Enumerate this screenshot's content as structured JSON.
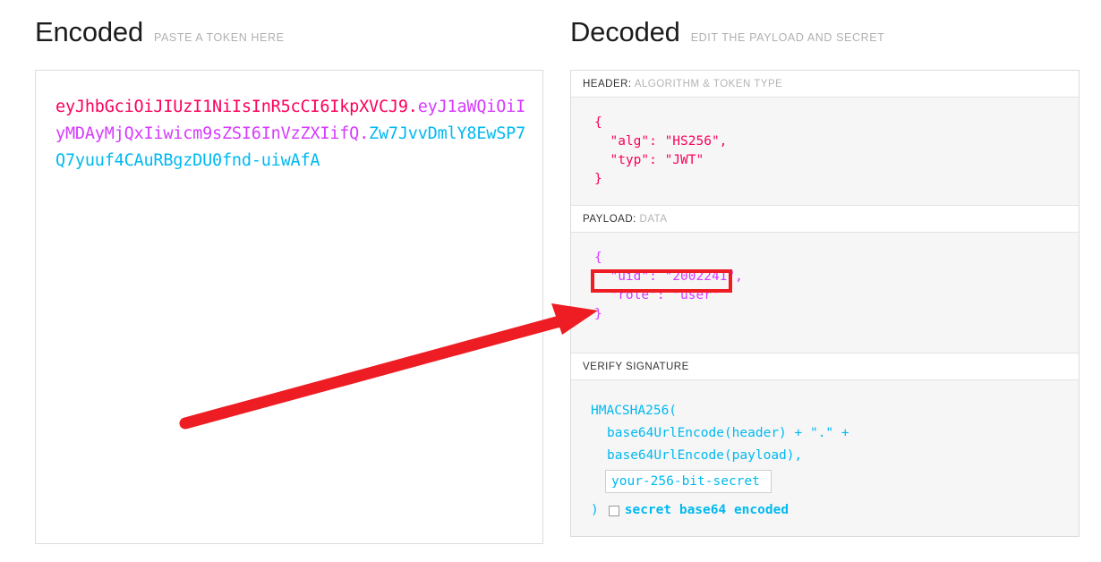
{
  "encoded": {
    "title": "Encoded",
    "subtitle": "PASTE A TOKEN HERE",
    "token": {
      "header": "eyJhbGciOiJIUzI1NiIsInR5cCI6IkpXVCJ9",
      "dot1": ".",
      "payload": "eyJ1aWQiOiIyMDAyMjQxIiwicm9sZSI6InVzZXIifQ",
      "dot2": ".",
      "signature": "Zw7JvvDmlY8EwSP7Q7yuuf4CAuRBgzDU0fnd-uiwAfA"
    }
  },
  "decoded": {
    "title": "Decoded",
    "subtitle": "EDIT THE PAYLOAD AND SECRET",
    "header_section": {
      "label": "HEADER:",
      "label_muted": "ALGORITHM & TOKEN TYPE",
      "lines": [
        "{",
        "  \"alg\": \"HS256\",",
        "  \"typ\": \"JWT\"",
        "}"
      ]
    },
    "payload_section": {
      "label": "PAYLOAD:",
      "label_muted": "DATA",
      "lines": [
        "{",
        "  \"uid\": \"2002241\",",
        "  \"role\": \"user\"",
        "}"
      ]
    },
    "signature_section": {
      "label": "VERIFY SIGNATURE",
      "line1": "HMACSHA256(",
      "line2": "base64UrlEncode(header) + \".\" +",
      "line3": "base64UrlEncode(payload),",
      "secret_value": "your-256-bit-secret",
      "secret_placeholder": "your-256-bit-secret",
      "closing_paren": ")",
      "base64_label": "secret base64 encoded",
      "base64_checked": false
    }
  },
  "annotation": {
    "arrow_color": "#ee1c23",
    "highlight_color": "#ee1c23",
    "arrow_from": "205,474",
    "arrow_to": "660,349"
  },
  "colors": {
    "header_segment": "#fb015b",
    "payload_segment": "#d63aff",
    "signature_segment": "#00b9f1"
  }
}
